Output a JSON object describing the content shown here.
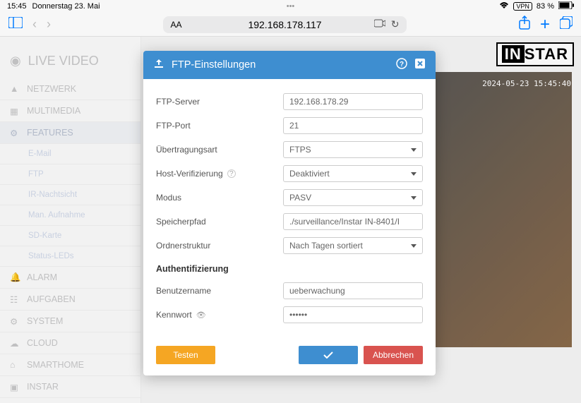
{
  "status": {
    "time": "15:45",
    "date": "Donnerstag 23. Mai",
    "vpn": "VPN",
    "battery": "83 %"
  },
  "browser": {
    "url": "192.168.178.117"
  },
  "logo": {
    "part1": "IN",
    "part2": "STAR"
  },
  "camera_timestamp": "2024-05-23 15:45:40",
  "sidebar": {
    "title": "LIVE VIDEO",
    "items": [
      {
        "label": "NETZWERK"
      },
      {
        "label": "MULTIMEDIA"
      },
      {
        "label": "FEATURES"
      },
      {
        "label": "ALARM"
      },
      {
        "label": "AUFGABEN"
      },
      {
        "label": "SYSTEM"
      },
      {
        "label": "CLOUD"
      },
      {
        "label": "SMARTHOME"
      },
      {
        "label": "INSTAR"
      }
    ],
    "subs": [
      {
        "label": "E-Mail"
      },
      {
        "label": "FTP"
      },
      {
        "label": "IR-Nachtsicht"
      },
      {
        "label": "Man. Aufnahme"
      },
      {
        "label": "SD-Karte"
      },
      {
        "label": "Status-LEDs"
      }
    ]
  },
  "modal": {
    "title": "FTP-Einstellungen",
    "fields": {
      "server_label": "FTP-Server",
      "server_value": "192.168.178.29",
      "port_label": "FTP-Port",
      "port_value": "21",
      "transfer_label": "Übertragungsart",
      "transfer_value": "FTPS",
      "hostverif_label": "Host-Verifizierung",
      "hostverif_value": "Deaktiviert",
      "mode_label": "Modus",
      "mode_value": "PASV",
      "path_label": "Speicherpfad",
      "path_value": "./surveillance/Instar IN-8401/I",
      "folder_label": "Ordnerstruktur",
      "folder_value": "Nach Tagen sortiert",
      "auth_title": "Authentifizierung",
      "user_label": "Benutzername",
      "user_value": "ueberwachung",
      "pass_label": "Kennwort",
      "pass_value": "••••••"
    },
    "buttons": {
      "test": "Testen",
      "cancel": "Abbrechen"
    }
  }
}
